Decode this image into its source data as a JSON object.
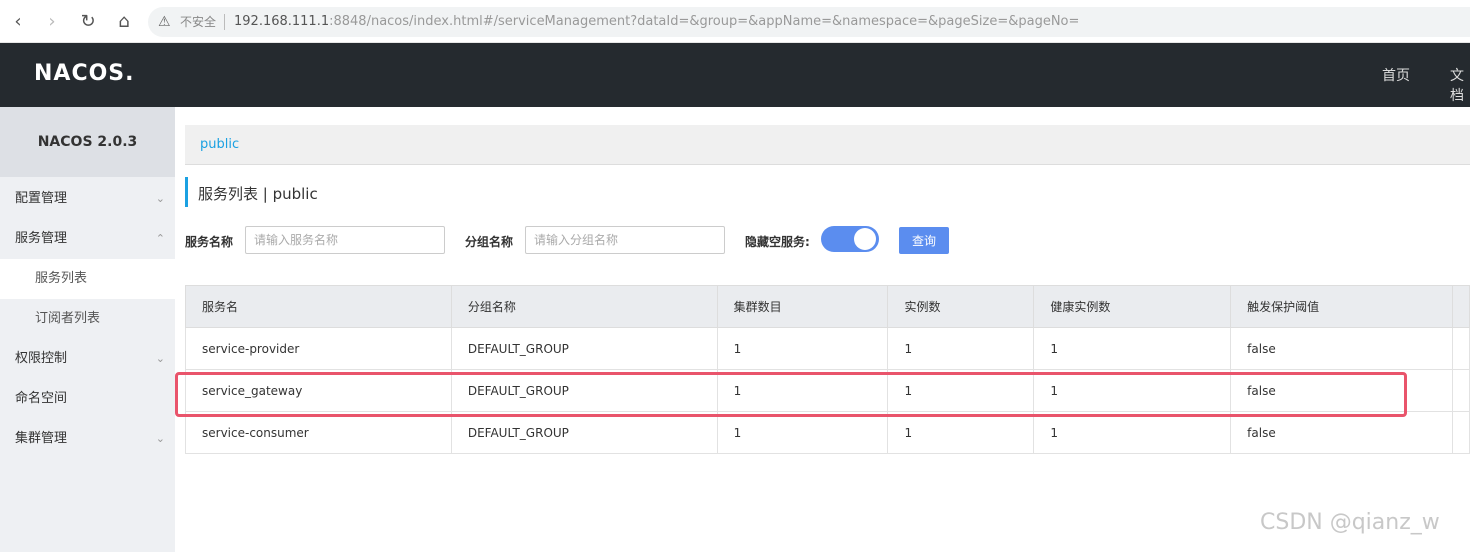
{
  "browser": {
    "insecure_label": "不安全",
    "url_host": "192.168.111.1",
    "url_rest": ":8848/nacos/index.html#/serviceManagement?dataId=&group=&appName=&namespace=&pageSize=&pageNo="
  },
  "header": {
    "logo": "NACOS.",
    "links": [
      "首页",
      "文档"
    ]
  },
  "sidebar": {
    "version": "NACOS 2.0.3",
    "items": [
      {
        "label": "配置管理",
        "chev": "⌄"
      },
      {
        "label": "服务管理",
        "chev": "⌃"
      },
      {
        "label": "服务列表"
      },
      {
        "label": "订阅者列表"
      },
      {
        "label": "权限控制",
        "chev": "⌄"
      },
      {
        "label": "命名空间"
      },
      {
        "label": "集群管理",
        "chev": "⌄"
      }
    ]
  },
  "main": {
    "breadcrumb": "public",
    "title": "服务列表  |  public",
    "filters": {
      "service_name_label": "服务名称",
      "service_name_placeholder": "请输入服务名称",
      "group_name_label": "分组名称",
      "group_name_placeholder": "请输入分组名称",
      "hide_empty_label": "隐藏空服务:",
      "query_label": "查询"
    },
    "table": {
      "headers": [
        "服务名",
        "分组名称",
        "集群数目",
        "实例数",
        "健康实例数",
        "触发保护阈值"
      ],
      "rows": [
        [
          "service-provider",
          "DEFAULT_GROUP",
          "1",
          "1",
          "1",
          "false"
        ],
        [
          "service_gateway",
          "DEFAULT_GROUP",
          "1",
          "1",
          "1",
          "false"
        ],
        [
          "service-consumer",
          "DEFAULT_GROUP",
          "1",
          "1",
          "1",
          "false"
        ]
      ]
    }
  },
  "watermark": "CSDN @qianz_w",
  "colors": {
    "accent": "#5b8def",
    "link": "#1ba1e2",
    "highlight": "#e9546b",
    "header_bg": "#252a2f"
  }
}
